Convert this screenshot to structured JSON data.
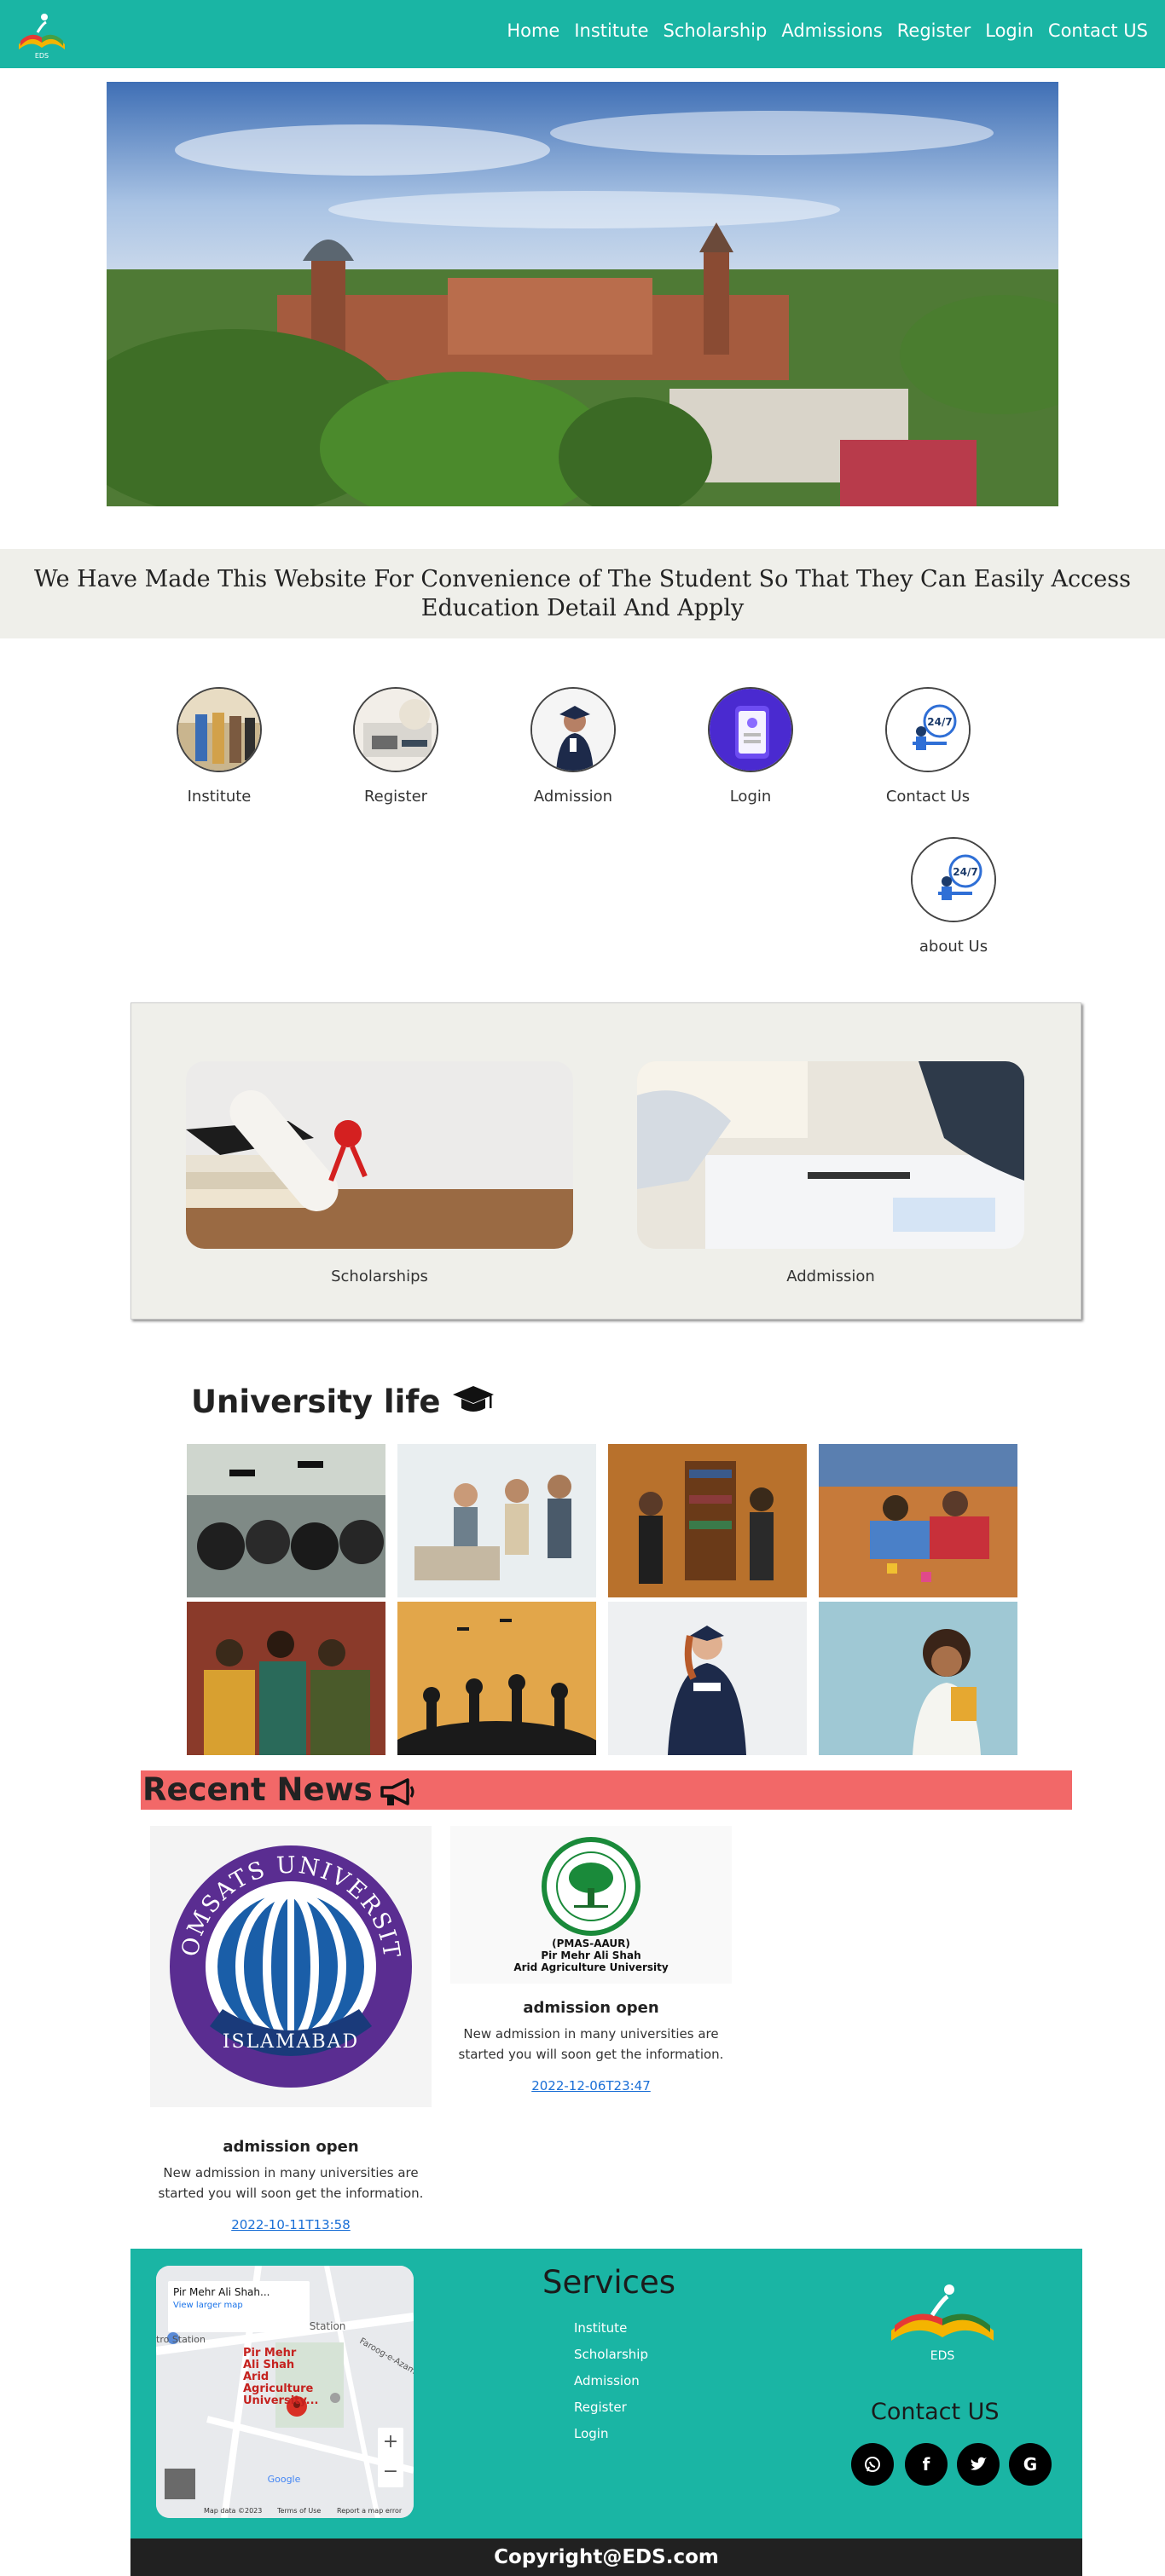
{
  "nav": {
    "logo_text": "EDS",
    "links": [
      "Home",
      "Institute",
      "Scholarship",
      "Admissions",
      "Register",
      "Login",
      "Contact US"
    ]
  },
  "tagline": "We Have Made This Website For Convenience of The Student So That They Can Easily Access Education Detail And Apply",
  "circles": [
    "Institute",
    "Register",
    "Admission",
    "Login",
    "Contact Us",
    "about Us"
  ],
  "cards": [
    "Scholarships",
    "Addmission"
  ],
  "university_life": {
    "title": "University life",
    "icon": "graduation-cap-icon"
  },
  "recent_news": {
    "title": "Recent News",
    "icon": "megaphone-icon"
  },
  "news": [
    {
      "logo_top": "COMSATS UNIVERSITY",
      "logo_bottom": "ISLAMABAD",
      "heading": "admission open",
      "text": "New admission in many universities are started you will soon get the information.",
      "date": "2022-10-11T13:58"
    },
    {
      "logo_line1": "(PMAS-AAUR)",
      "logo_line2": "Pir Mehr Ali Shah",
      "logo_line3": "Arid Agriculture University",
      "heading": "admission open",
      "text": "New admission in many universities are started you will soon get the information.",
      "date": "2022-12-06T23:47"
    }
  ],
  "map": {
    "place_title": "Pir Mehr Ali Shah...",
    "larger_map": "View larger map",
    "pin_label": "Pir Mehr Ali Shah Arid Agriculture University...",
    "metro_label": "Metrobus Station",
    "station_label": "tro Station",
    "road_label": "Faroog-e-Azam Rd",
    "map_data": "Map data ©2023",
    "terms": "Terms of Use",
    "report": "Report a map error",
    "google": "Google"
  },
  "services": {
    "title": "Services",
    "items": [
      "Institute",
      "Scholarship",
      "Admission",
      "Register",
      "Login"
    ]
  },
  "contact": {
    "title": "Contact US",
    "logo_text": "EDS"
  },
  "social": [
    {
      "name": "whatsapp-icon",
      "glyph": "✆"
    },
    {
      "name": "facebook-icon",
      "glyph": "f"
    },
    {
      "name": "twitter-icon",
      "glyph": "🐦"
    },
    {
      "name": "google-icon",
      "glyph": "G"
    }
  ],
  "copyright": "Copyright@EDS.com",
  "colors": {
    "teal": "#1ab5a4",
    "news_bar": "#f26868",
    "panel": "#efefea",
    "dark": "#212121"
  }
}
